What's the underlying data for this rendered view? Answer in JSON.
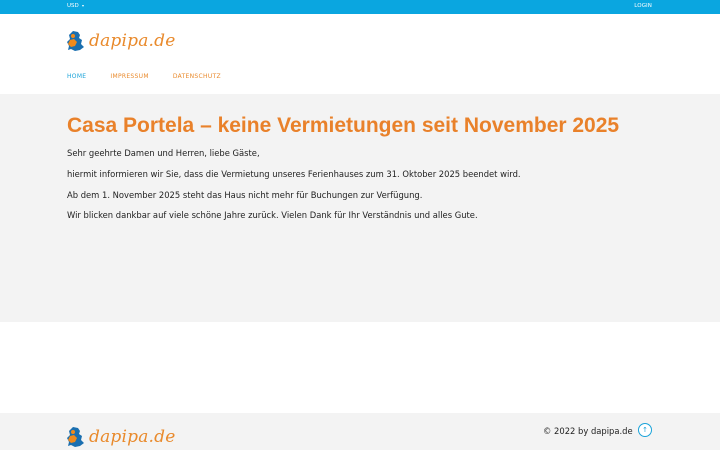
{
  "topbar": {
    "currency_label": "USD",
    "login_label": "LOGIN",
    "color": "#0aa6e0"
  },
  "brand": {
    "logo_text": "dapipa.de",
    "logo_color": "#e98a2c",
    "logo_icon": "map-pin-logo-icon"
  },
  "nav": {
    "items": [
      {
        "label": "HOME",
        "active": true
      },
      {
        "label": "IMPRESSUM",
        "active": false
      },
      {
        "label": "DATENSCHUTZ",
        "active": false
      }
    ]
  },
  "main": {
    "title": "Casa Portela – keine Vermietungen seit November 2025",
    "paragraphs": [
      "Sehr geehrte Damen und Herren, liebe Gäste,",
      "hiermit informieren wir Sie, dass die Vermietung unseres Ferienhauses zum 31. Oktober 2025 beendet wird.",
      "Ab dem 1. November 2025 steht das Haus nicht mehr für Buchungen zur Verfügung.",
      "Wir blicken dankbar auf viele schöne Jahre zurück. Vielen Dank für Ihr Verständnis und alles Gute."
    ]
  },
  "footer": {
    "logo_text": "dapipa.de",
    "copyright": "© 2022 by dapipa.de",
    "back_to_top_icon": "arrow-up-icon",
    "back_to_top_glyph": "↑"
  }
}
